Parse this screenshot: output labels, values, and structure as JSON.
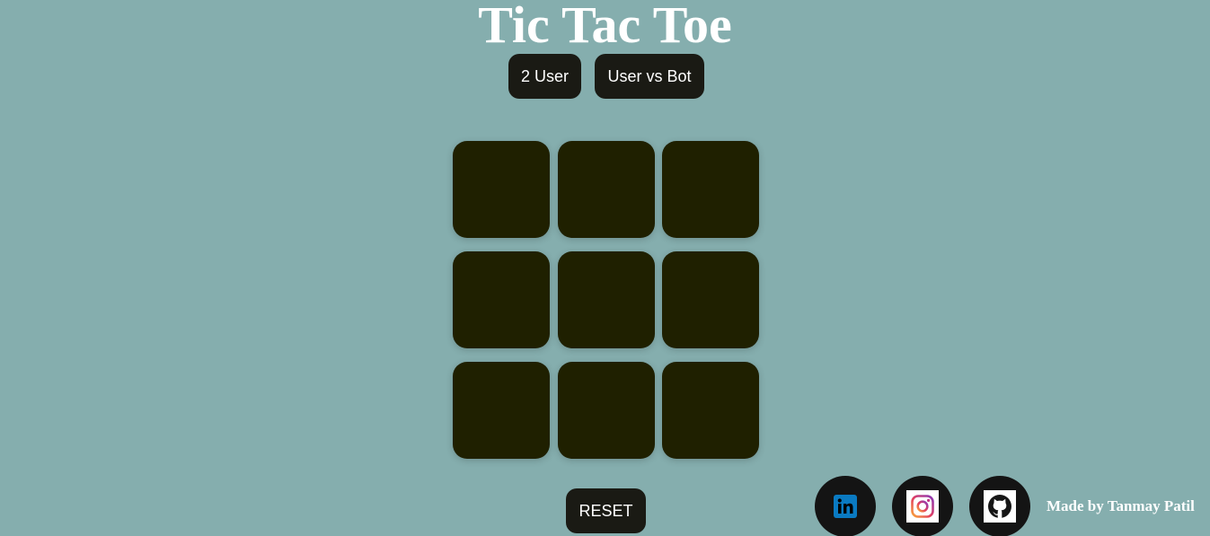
{
  "title": "Tic Tac Toe",
  "modes": {
    "two_user": "2 User",
    "user_vs_bot": "User vs Bot"
  },
  "board": {
    "cells": [
      "",
      "",
      "",
      "",
      "",
      "",
      "",
      "",
      ""
    ]
  },
  "reset_label": "RESET",
  "social": {
    "icons": [
      "linkedin-icon",
      "instagram-icon",
      "github-icon"
    ]
  },
  "credit": "Made by Tanmay Patil",
  "colors": {
    "background": "#85aeae",
    "button": "#1a1a14",
    "cell": "#1f2000",
    "linkedin": "#0a66c2"
  }
}
